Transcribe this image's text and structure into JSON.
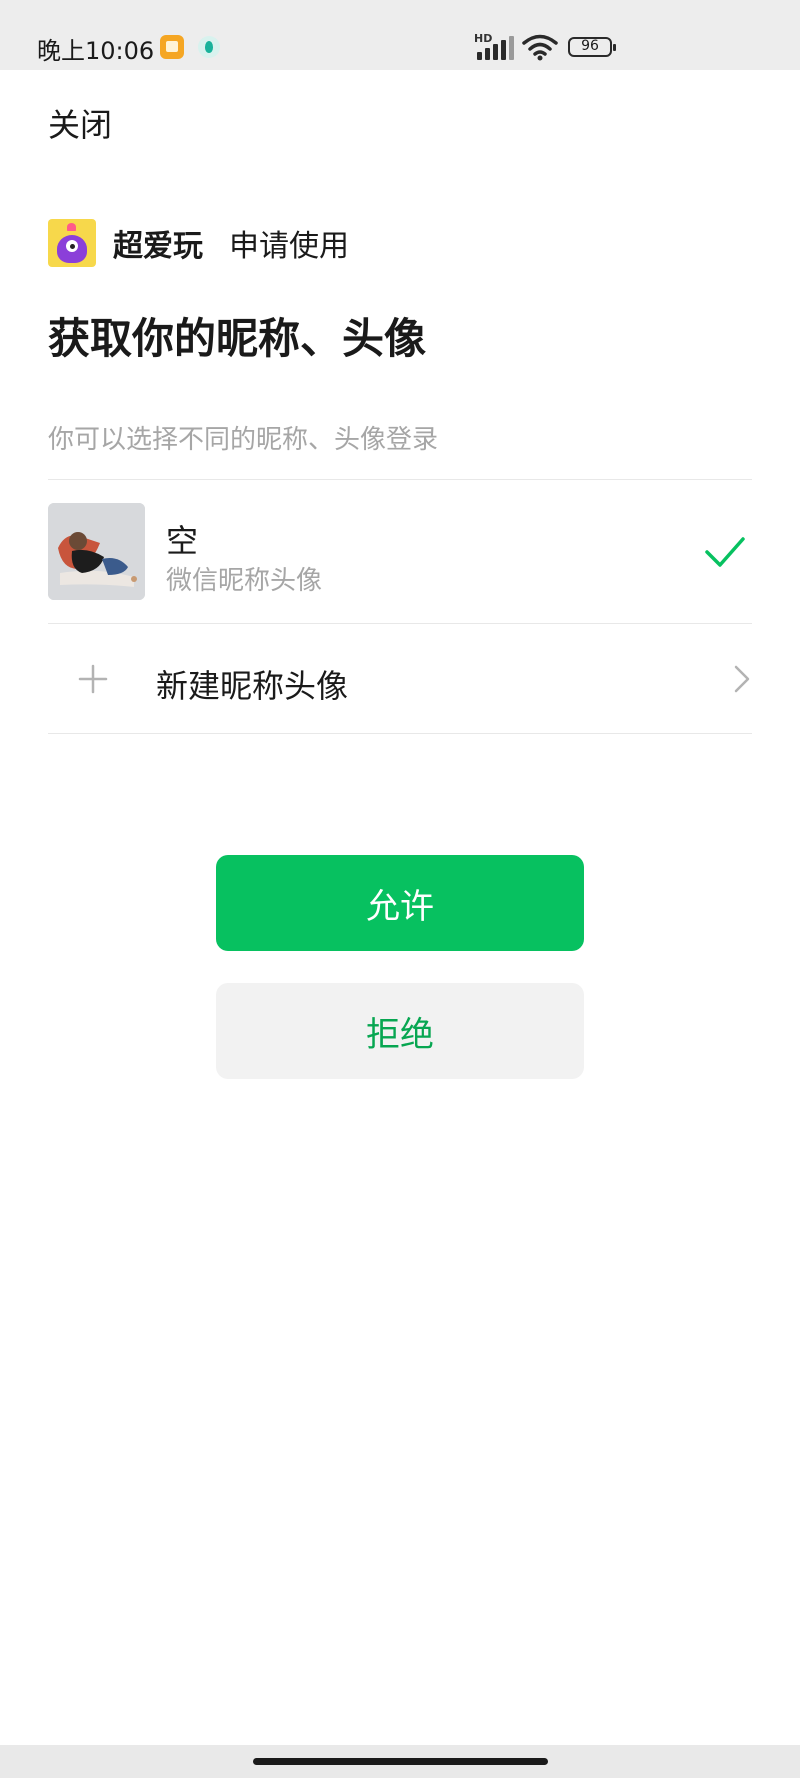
{
  "status_bar": {
    "time": "晚上10:06",
    "network_label": "HD",
    "battery": "96"
  },
  "header": {
    "close_label": "关闭"
  },
  "app": {
    "name": "超爱玩",
    "request_text": "申请使用",
    "logo_icon": "purple-monster-logo"
  },
  "main": {
    "title": "获取你的昵称、头像",
    "subtitle": "你可以选择不同的昵称、头像登录"
  },
  "profile": {
    "name": "空",
    "description": "微信昵称头像",
    "selected": true
  },
  "new_profile": {
    "label": "新建昵称头像"
  },
  "actions": {
    "allow_label": "允许",
    "deny_label": "拒绝"
  },
  "colors": {
    "accent": "#07c160",
    "deny_text": "#07a651",
    "muted_text": "#a6a6a6",
    "status_bar_bg": "#ededed"
  }
}
